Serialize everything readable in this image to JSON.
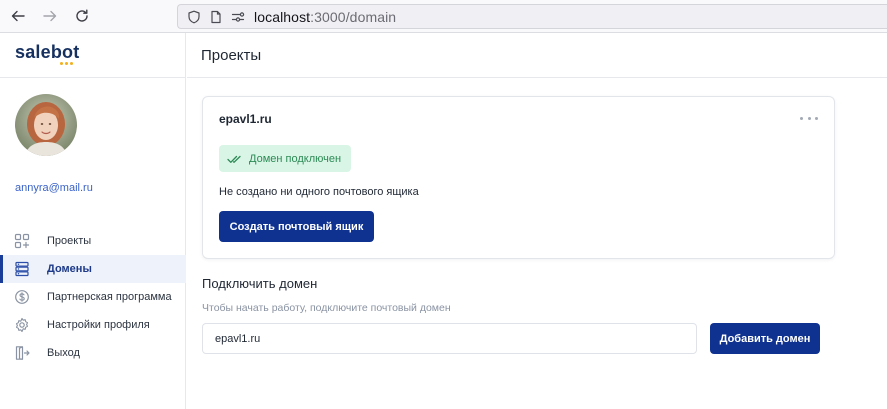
{
  "browser": {
    "url_host": "localhost",
    "url_path": ":3000/domain",
    "icons": {
      "back": "arrow-left-icon",
      "forward": "arrow-right-icon",
      "reload": "reload-icon",
      "shield": "shield-icon",
      "page": "page-icon",
      "permissions": "permissions-icon"
    }
  },
  "sidebar": {
    "logo": "salebot",
    "user_email": "annyra@mail.ru",
    "items": [
      {
        "label": "Проекты",
        "icon": "grid-icon",
        "active": false
      },
      {
        "label": "Домены",
        "icon": "server-icon",
        "active": true
      },
      {
        "label": "Партнерская программа",
        "icon": "dollar-circle-icon",
        "active": false
      },
      {
        "label": "Настройки профиля",
        "icon": "gear-icon",
        "active": false
      },
      {
        "label": "Выход",
        "icon": "logout-icon",
        "active": false
      }
    ]
  },
  "header": {
    "title": "Проекты"
  },
  "domain_card": {
    "domain": "epavl1.ru",
    "status": "Домен подключен",
    "empty_text": "Не создано ни одного почтового ящика",
    "create_button": "Создать почтовый ящик"
  },
  "connect": {
    "title": "Подключить домен",
    "hint": "Чтобы начать работу, подключите почтовый домен",
    "input_value": "epavl1.ru",
    "button": "Добавить домен"
  },
  "colors": {
    "primary": "#0f3190",
    "accent": "#1a3d9a",
    "success_bg": "#d9f5e6",
    "success_text": "#2c8a55",
    "link": "#3a62c8",
    "logo_dots": "#f2b01e"
  }
}
